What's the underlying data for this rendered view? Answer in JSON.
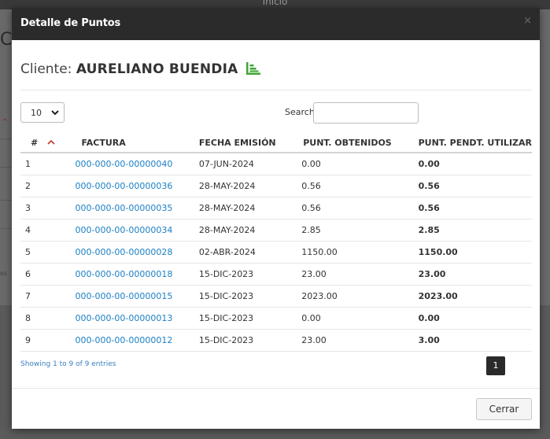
{
  "background": {
    "top_label": "Inicio",
    "heading_fragment": "Ci",
    "side_fragment": "es"
  },
  "modal": {
    "title": "Detalle de Puntos",
    "close_glyph": "×",
    "client_label": "Cliente:",
    "client_name": "AURELIANO BUENDIA",
    "client_icon": "bar-chart-icon",
    "accent_color": "#3fa535"
  },
  "table_controls": {
    "page_length_value": "10",
    "search_label": "Search:",
    "search_value": ""
  },
  "table": {
    "headers": [
      "#",
      "FACTURA",
      "FECHA EMISIÓN",
      "PUNT. OBTENIDOS",
      "PUNT. PENDT. UTILIZAR"
    ],
    "rows": [
      {
        "n": "1",
        "factura": "000-000-00-00000040",
        "fecha": "07-JUN-2024",
        "obtenidos": "0.00",
        "pendientes": "0.00",
        "status": "neg"
      },
      {
        "n": "2",
        "factura": "000-000-00-00000036",
        "fecha": "28-MAY-2024",
        "obtenidos": "0.56",
        "pendientes": "0.56",
        "status": "pos"
      },
      {
        "n": "3",
        "factura": "000-000-00-00000035",
        "fecha": "28-MAY-2024",
        "obtenidos": "0.56",
        "pendientes": "0.56",
        "status": "pos"
      },
      {
        "n": "4",
        "factura": "000-000-00-00000034",
        "fecha": "28-MAY-2024",
        "obtenidos": "2.85",
        "pendientes": "2.85",
        "status": "pos"
      },
      {
        "n": "5",
        "factura": "000-000-00-00000028",
        "fecha": "02-ABR-2024",
        "obtenidos": "1150.00",
        "pendientes": "1150.00",
        "status": "pos"
      },
      {
        "n": "6",
        "factura": "000-000-00-00000018",
        "fecha": "15-DIC-2023",
        "obtenidos": "23.00",
        "pendientes": "23.00",
        "status": "pos"
      },
      {
        "n": "7",
        "factura": "000-000-00-00000015",
        "fecha": "15-DIC-2023",
        "obtenidos": "2023.00",
        "pendientes": "2023.00",
        "status": "pos"
      },
      {
        "n": "8",
        "factura": "000-000-00-00000013",
        "fecha": "15-DIC-2023",
        "obtenidos": "0.00",
        "pendientes": "0.00",
        "status": "neg"
      },
      {
        "n": "9",
        "factura": "000-000-00-00000012",
        "fecha": "15-DIC-2023",
        "obtenidos": "23.00",
        "pendientes": "3.00",
        "status": "neg"
      }
    ],
    "colors": {
      "link": "#1a7fc4",
      "positive": "#3fa535",
      "negative": "#a02020"
    }
  },
  "footer": {
    "info": "Showing 1 to 9 of 9 entries",
    "current_page": "1",
    "close_label": "Cerrar"
  }
}
